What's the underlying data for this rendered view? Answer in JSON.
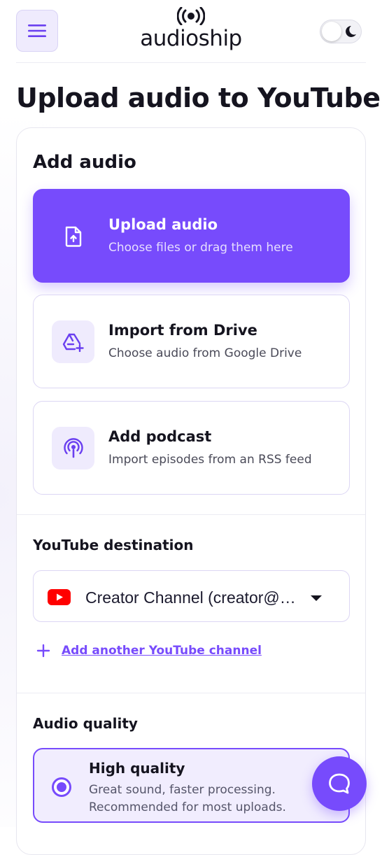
{
  "header": {
    "brand": "audioship",
    "menu_icon": "hamburger-menu-icon",
    "logo_icon": "broadcast-icon",
    "theme_toggle_icon": "moon-icon",
    "theme_toggle_state": "light"
  },
  "page": {
    "title": "Upload audio to YouTube"
  },
  "add_audio": {
    "title": "Add audio",
    "options": [
      {
        "title": "Upload audio",
        "subtitle": "Choose files or drag them here",
        "icon": "file-upload-icon",
        "selected": true
      },
      {
        "title": "Import from Drive",
        "subtitle": "Choose audio from Google Drive",
        "icon": "google-drive-add-icon"
      },
      {
        "title": "Add podcast",
        "subtitle": "Import episodes from an RSS feed",
        "icon": "podcast-icon"
      }
    ]
  },
  "destination": {
    "title": "YouTube destination",
    "selected_channel": "Creator Channel (creator@…",
    "channel_icon": "youtube-icon",
    "add_channel_label": "Add another YouTube channel"
  },
  "quality": {
    "title": "Audio quality",
    "options": [
      {
        "title": "High quality",
        "description": "Great sound, faster processing. Recommended for most uploads.",
        "selected": true
      }
    ]
  },
  "chat": {
    "icon": "chat-bubble-icon"
  },
  "colors": {
    "accent": "#774bfc",
    "accent_light": "#efebfd",
    "youtube_red": "#ff0000",
    "text_dark": "#15141f"
  }
}
